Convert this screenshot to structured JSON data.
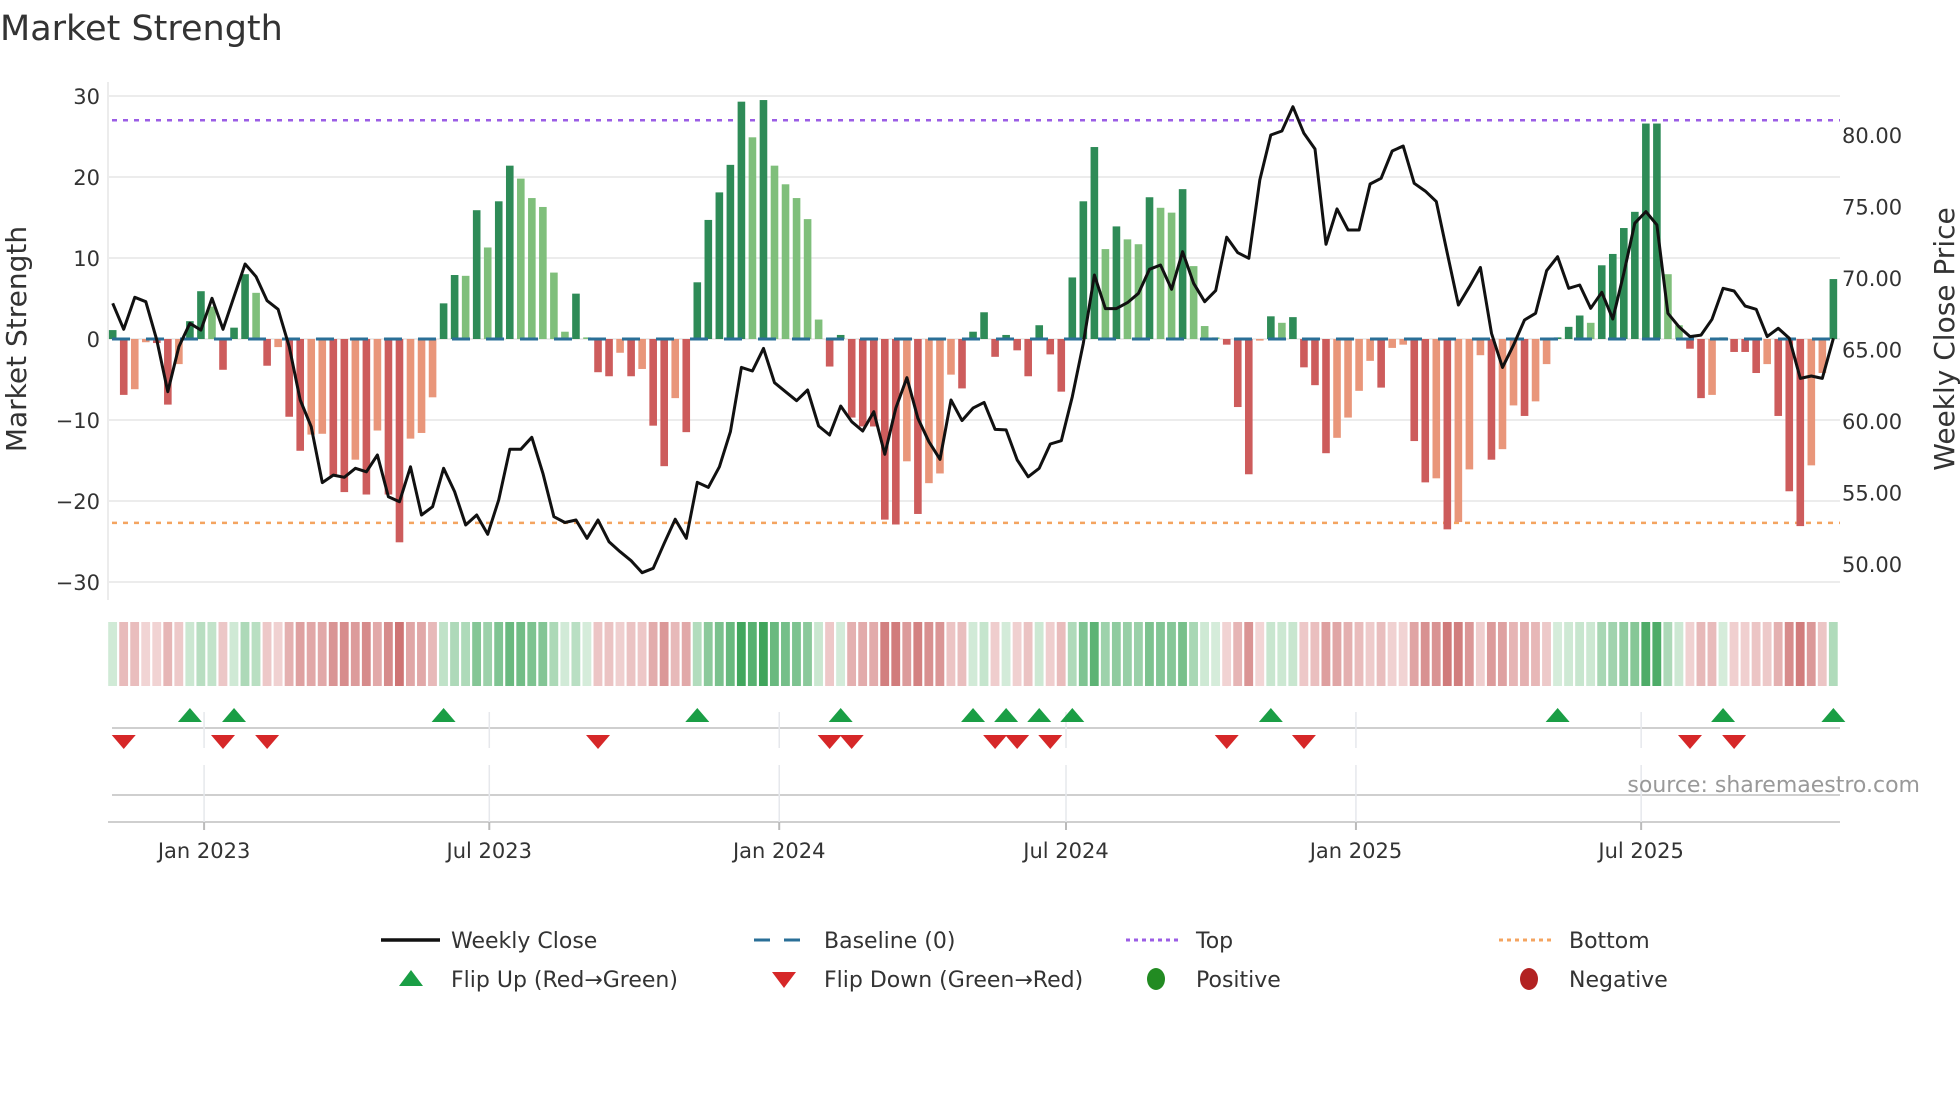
{
  "chart_data": {
    "type": "bar",
    "title": "Market Strength",
    "ylabel": "Market Strength",
    "y2label": "Weekly Close Price",
    "ylim": [
      -30,
      30
    ],
    "y2lim": [
      48,
      82
    ],
    "x_start": "2022-11-04",
    "x_step_days": 7,
    "y_ticks": [
      "−30",
      "−20",
      "−10",
      "0",
      "10",
      "20",
      "30"
    ],
    "y_tick_values": [
      -30,
      -20,
      -10,
      0,
      10,
      20,
      30
    ],
    "y2_ticks": [
      "50.00",
      "55.00",
      "60.00",
      "65.00",
      "70.00",
      "75.00",
      "80.00"
    ],
    "y2_tick_values": [
      50,
      55,
      60,
      65,
      70,
      75,
      80
    ],
    "x_ticks": [
      {
        "label": "Jan 2023",
        "date": "2023-01-01"
      },
      {
        "label": "Jul 2023",
        "date": "2023-07-01"
      },
      {
        "label": "Jan 2024",
        "date": "2024-01-01"
      },
      {
        "label": "Jul 2024",
        "date": "2024-07-01"
      },
      {
        "label": "Jan 2025",
        "date": "2025-01-01"
      },
      {
        "label": "Jul 2025",
        "date": "2025-07-01"
      }
    ],
    "top_level": 27.0,
    "bottom_level": -22.7,
    "baseline": 0,
    "strength": [
      1.1,
      -6.9,
      -6.2,
      -0.4,
      -0.5,
      -8.1,
      -3.1,
      2.2,
      5.9,
      4.0,
      -3.8,
      1.4,
      8.0,
      5.7,
      -3.3,
      -1.0,
      -9.6,
      -13.8,
      -11.8,
      -11.7,
      -16.9,
      -18.9,
      -14.9,
      -19.2,
      -11.3,
      -19.2,
      -25.1,
      -12.3,
      -11.6,
      -7.2,
      4.4,
      7.9,
      7.8,
      15.9,
      11.3,
      17.0,
      21.4,
      19.8,
      17.4,
      16.3,
      8.2,
      0.9,
      5.6,
      0.2,
      -4.1,
      -4.6,
      -1.7,
      -4.6,
      -3.7,
      -10.7,
      -15.7,
      -7.3,
      -11.5,
      7.0,
      14.7,
      18.1,
      21.5,
      29.3,
      24.9,
      29.5,
      21.4,
      19.1,
      17.4,
      14.8,
      2.4,
      -3.4,
      0.5,
      -9.7,
      -10.8,
      -10.8,
      -22.3,
      -22.9,
      -15.1,
      -21.6,
      -17.8,
      -16.6,
      -4.4,
      -6.1,
      0.9,
      3.3,
      -2.2,
      0.5,
      -1.4,
      -4.6,
      1.7,
      -1.9,
      -6.5,
      7.6,
      17.0,
      23.7,
      11.1,
      13.9,
      12.3,
      11.7,
      17.5,
      16.2,
      15.6,
      18.5,
      9.0,
      1.6,
      0.2,
      -0.7,
      -8.4,
      -16.7,
      -0.2,
      2.8,
      2.0,
      2.7,
      -3.5,
      -5.7,
      -14.1,
      -12.2,
      -9.7,
      -6.4,
      -2.7,
      -6.0,
      -1.1,
      -0.7,
      -12.6,
      -17.7,
      -17.2,
      -23.5,
      -22.6,
      -16.1,
      -2.0,
      -14.9,
      -13.6,
      -8.2,
      -9.5,
      -7.7,
      -3.1,
      0.2,
      1.5,
      2.9,
      2.0,
      9.1,
      10.5,
      13.7,
      15.7,
      26.6,
      26.6,
      8.0,
      1.7,
      -1.2,
      -7.3,
      -6.9,
      0.2,
      -1.6,
      -1.6,
      -4.2,
      -3.1,
      -9.5,
      -18.8,
      -23.1,
      -15.6,
      -4.2,
      7.4
    ],
    "weekly_close": [
      68.23,
      66.41,
      68.65,
      68.34,
      65.66,
      62.05,
      65.2,
      66.83,
      66.36,
      68.58,
      66.41,
      68.7,
      70.98,
      70.09,
      68.41,
      67.81,
      65.2,
      61.47,
      59.6,
      55.69,
      56.22,
      56.06,
      56.69,
      56.45,
      57.62,
      54.7,
      54.36,
      56.8,
      53.43,
      54.01,
      56.69,
      55.06,
      52.73,
      53.43,
      52.08,
      54.48,
      58.02,
      58.02,
      58.86,
      56.34,
      53.31,
      52.9,
      53.08,
      51.8,
      53.08,
      51.56,
      50.86,
      50.23,
      49.39,
      49.7,
      51.45,
      53.13,
      51.8,
      55.71,
      55.36,
      56.8,
      59.25,
      63.75,
      63.5,
      65.08,
      62.68,
      62.05,
      61.42,
      62.17,
      59.65,
      59.02,
      61.05,
      59.95,
      59.3,
      60.65,
      57.67,
      60.9,
      63.03,
      60.19,
      58.55,
      57.32,
      61.47,
      60.03,
      60.9,
      61.3,
      59.41,
      59.38,
      57.27,
      56.1,
      56.69,
      58.39,
      58.62,
      61.7,
      65.43,
      70.21,
      67.86,
      67.86,
      68.28,
      68.93,
      70.61,
      70.91,
      69.21,
      71.84,
      69.63,
      68.34,
      69.12,
      72.85,
      71.77,
      71.38,
      76.85,
      80.0,
      80.28,
      81.98,
      80.12,
      79.02,
      72.36,
      74.83,
      73.36,
      73.36,
      76.57,
      76.97,
      78.88,
      79.23,
      76.62,
      76.08,
      75.34,
      71.73,
      68.11,
      69.39,
      70.74,
      66.13,
      63.75,
      65.31,
      67.06,
      67.53,
      70.51,
      71.49,
      69.28,
      69.51,
      67.88,
      69.0,
      67.13,
      70.33,
      73.83,
      74.64,
      73.71,
      67.53,
      66.59,
      65.9,
      66.01,
      67.11,
      69.28,
      69.09,
      68.04,
      67.81,
      65.9,
      66.48,
      65.78,
      62.98,
      63.15,
      62.98,
      65.78
    ],
    "legend": {
      "weekly_close": "Weekly Close",
      "baseline": "Baseline (0)",
      "top": "Top",
      "bottom": "Bottom",
      "flip_up": "Flip Up (Red→Green)",
      "flip_down": "Flip Down (Green→Red)",
      "positive": "Positive",
      "negative": "Negative"
    },
    "legend_position": "bottom",
    "source": "source: sharemaestro.com",
    "colors": {
      "pos_strong": "#2e8b57",
      "pos_weak": "#7fbf7b",
      "neg_strong": "#cd5c5c",
      "neg_weak": "#e9967a",
      "close": "#111111",
      "baseline": "#2a6f97",
      "top": "#9b5de5",
      "bottom": "#f4a460",
      "flip_up": "#1a9e45",
      "flip_down": "#d62728",
      "positive": "#228b22",
      "negative": "#b22222"
    }
  }
}
